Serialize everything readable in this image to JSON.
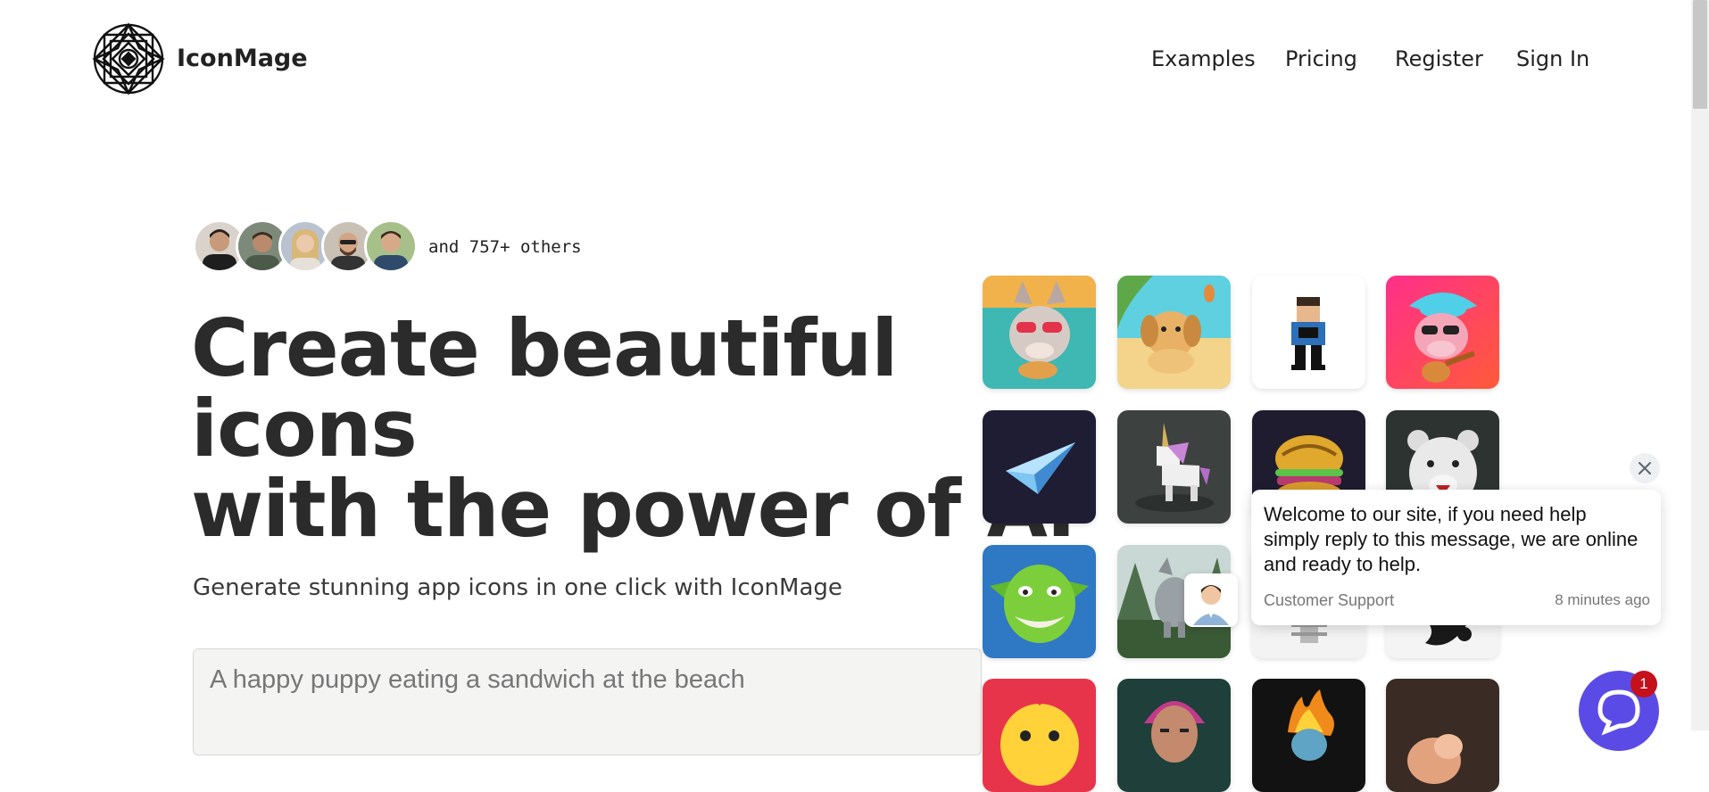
{
  "header": {
    "brand": "IconMage",
    "logo_icon": "mandala-logo-icon",
    "nav": [
      {
        "label": "Examples"
      },
      {
        "label": "Pricing"
      },
      {
        "label": "Register"
      },
      {
        "label": "Sign In"
      }
    ]
  },
  "hero": {
    "social_proof": "and 757+ others",
    "headline_lines": [
      "Create beautiful",
      "icons",
      "with the power of AI"
    ],
    "subtitle": "Generate stunning app icons in one click with IconMage",
    "prompt_placeholder": "A happy puppy eating a sandwich at the beach"
  },
  "gallery": {
    "icons": [
      "wolf-sunglasses-icon",
      "puppy-beach-icon",
      "pixel-person-icon",
      "cow-guitar-icon",
      "paper-plane-icon",
      "unicorn-icon",
      "burger-icon",
      "polar-bear-icon",
      "goblin-icon",
      "wolf-forest-icon",
      "skeleton-icon",
      "abstract-dark-icon",
      "lemon-face-icon",
      "portrait-icon",
      "fire-skull-icon",
      "peach-icon"
    ]
  },
  "chat": {
    "message": "Welcome to our site, if you need help simply reply to this message, we are online and ready to help.",
    "sender": "Customer Support",
    "time": "8 minutes ago",
    "badge_count": "1",
    "close_icon": "close-icon",
    "launcher_icon": "chat-bubble-icon"
  },
  "colors": {
    "text": "#2b2b2b",
    "chat_accent": "#5b4be6",
    "badge": "#c4111c"
  }
}
